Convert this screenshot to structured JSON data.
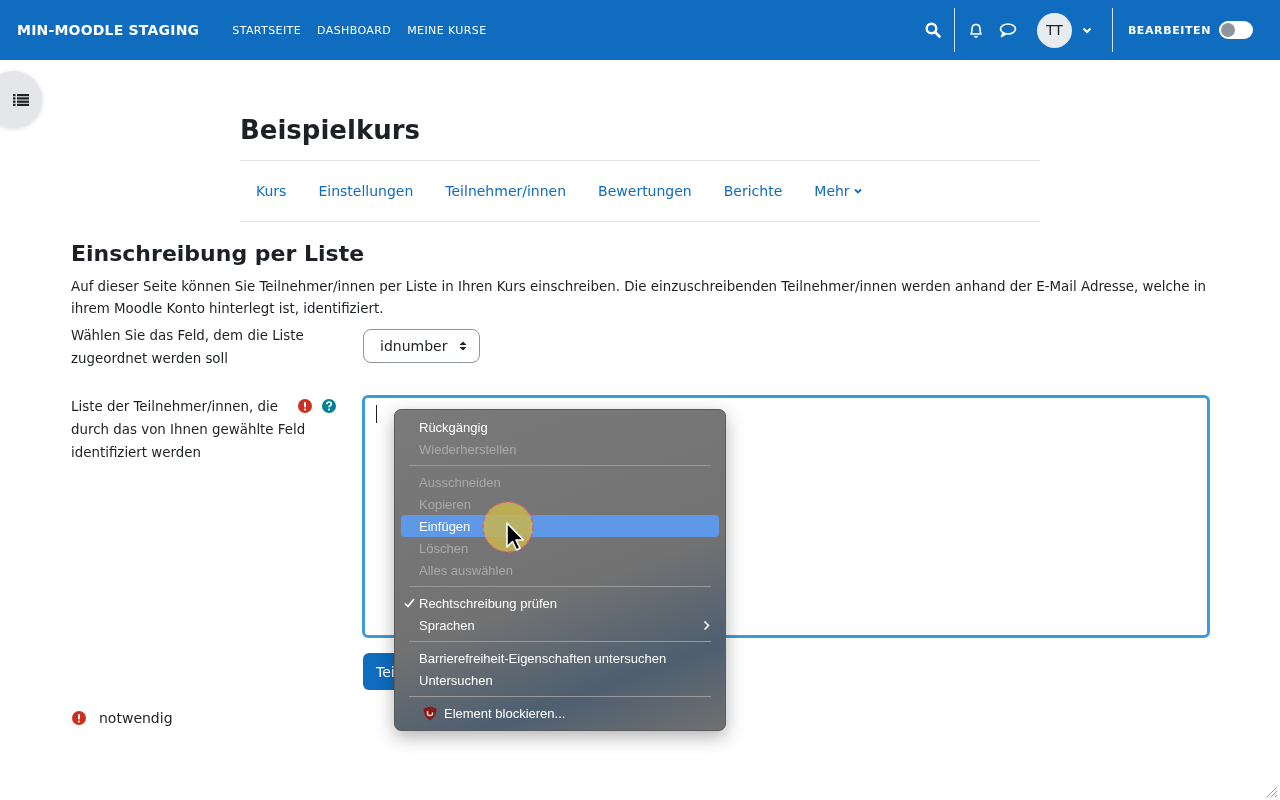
{
  "navbar": {
    "site_name": "MIN-MOODLE STAGING",
    "links": [
      "STARTSEITE",
      "DASHBOARD",
      "MEINE KURSE"
    ],
    "avatar": "TT",
    "edit_label": "BEARBEITEN",
    "edit_on": false
  },
  "course": {
    "title": "Beispielkurs",
    "tabs": [
      {
        "label": "Kurs",
        "selected": false,
        "dropdown": false
      },
      {
        "label": "Einstellungen",
        "selected": false,
        "dropdown": false
      },
      {
        "label": "Teilnehmer/innen",
        "selected": false,
        "dropdown": false
      },
      {
        "label": "Bewertungen",
        "selected": false,
        "dropdown": false
      },
      {
        "label": "Berichte",
        "selected": false,
        "dropdown": false
      },
      {
        "label": "Mehr",
        "selected": false,
        "dropdown": true
      }
    ]
  },
  "page": {
    "heading": "Einschreibung per Liste",
    "intro": "Auf dieser Seite können Sie Teilnehmer/innen per Liste in Ihren Kurs einschreiben. Die einzuschreibenden Teilnehmer/innen werden anhand der E-Mail Adresse, welche in ihrem Moodle Konto hinterlegt ist, identifiziert.",
    "field_label": "Wählen Sie das Feld, dem die Liste zugeordnet werden soll",
    "field_value": "idnumber",
    "list_label": "Liste der Teilnehmer/innen, die durch das von Ihnen gewählte Feld identifiziert werden",
    "list_required": true,
    "list_focused": true,
    "submit_label": "Tei",
    "required_note": "notwendig"
  },
  "context_menu": {
    "items": [
      {
        "kind": "item",
        "label": "Rückgängig",
        "disabled": false,
        "selected": false,
        "checked": false,
        "submenu": false
      },
      {
        "kind": "item",
        "label": "Wiederherstellen",
        "disabled": true,
        "selected": false,
        "checked": false,
        "submenu": false
      },
      {
        "kind": "separator"
      },
      {
        "kind": "item",
        "label": "Ausschneiden",
        "disabled": true,
        "selected": false,
        "checked": false,
        "submenu": false
      },
      {
        "kind": "item",
        "label": "Kopieren",
        "disabled": true,
        "selected": false,
        "checked": false,
        "submenu": false
      },
      {
        "kind": "item",
        "label": "Einfügen",
        "disabled": false,
        "selected": true,
        "checked": false,
        "submenu": false
      },
      {
        "kind": "item",
        "label": "Löschen",
        "disabled": true,
        "selected": false,
        "checked": false,
        "submenu": false
      },
      {
        "kind": "item",
        "label": "Alles auswählen",
        "disabled": true,
        "selected": false,
        "checked": false,
        "submenu": false
      },
      {
        "kind": "separator"
      },
      {
        "kind": "item",
        "label": "Rechtschreibung prüfen",
        "disabled": false,
        "selected": false,
        "checked": true,
        "submenu": false
      },
      {
        "kind": "item",
        "label": "Sprachen",
        "disabled": false,
        "selected": false,
        "checked": false,
        "submenu": true
      },
      {
        "kind": "separator"
      },
      {
        "kind": "item",
        "label": "Barrierefreiheit-Eigenschaften untersuchen",
        "disabled": false,
        "selected": false,
        "checked": false,
        "submenu": false
      },
      {
        "kind": "item",
        "label": "Untersuchen",
        "disabled": false,
        "selected": false,
        "checked": false,
        "submenu": false
      },
      {
        "kind": "separator"
      },
      {
        "kind": "extension",
        "label": "Element blockieren...",
        "disabled": false,
        "selected": false,
        "checked": false,
        "submenu": false
      }
    ]
  }
}
